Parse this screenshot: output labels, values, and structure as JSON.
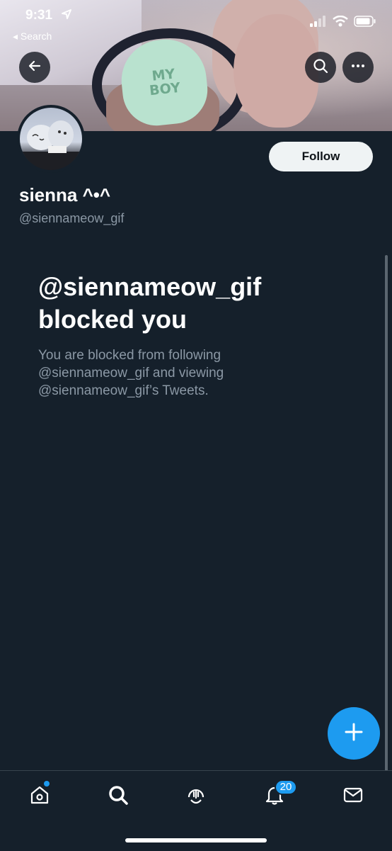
{
  "status_bar": {
    "time": "9:31",
    "back_label": "◂ Search"
  },
  "banner": {
    "heart_line1": "MY",
    "heart_line2": "BOY"
  },
  "profile": {
    "display_name": "sienna ^•^",
    "handle": "@siennameow_gif",
    "follow_label": "Follow"
  },
  "blocked": {
    "title": "@siennameow_gif blocked you",
    "description": "You are blocked from following @siennameow_gif and viewing @siennameow_gif’s Tweets."
  },
  "tabbar": {
    "notifications_count": "20"
  },
  "colors": {
    "background": "#15202b",
    "accent": "#1d9bf0",
    "muted": "#8b98a5"
  },
  "icons": [
    "location-arrow-icon",
    "cellular-icon",
    "wifi-icon",
    "battery-icon",
    "back-arrow-icon",
    "search-icon",
    "more-icon",
    "plus-icon",
    "home-icon",
    "explore-icon",
    "spaces-icon",
    "bell-icon",
    "mail-icon"
  ]
}
